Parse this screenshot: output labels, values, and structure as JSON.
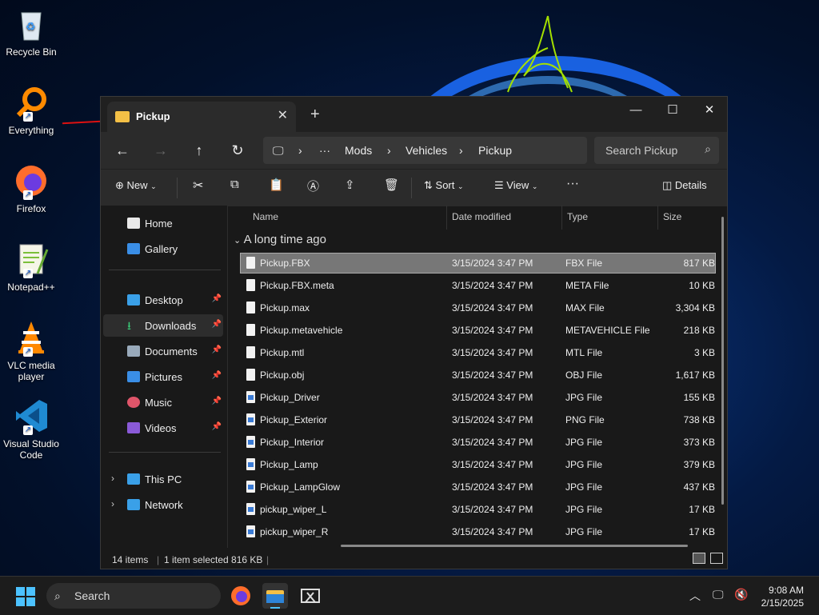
{
  "desktop": {
    "icons": [
      {
        "label": "Recycle Bin",
        "icon": "recycle-bin-icon"
      },
      {
        "label": "Everything",
        "icon": "everything-search-icon"
      },
      {
        "label": "Firefox",
        "icon": "firefox-icon"
      },
      {
        "label": "Notepad++",
        "icon": "notepadpp-icon"
      },
      {
        "label": "VLC media player",
        "icon": "vlc-icon"
      },
      {
        "label": "Visual Studio Code",
        "icon": "vscode-icon"
      }
    ]
  },
  "window": {
    "tab_title": "Pickup",
    "address": {
      "more": "···",
      "crumbs": [
        "Mods",
        "Vehicles",
        "Pickup"
      ]
    },
    "search_placeholder": "Search Pickup",
    "toolbar": {
      "new": "New",
      "sort": "Sort",
      "view": "View",
      "more": "···",
      "details": "Details"
    },
    "sidebar": {
      "home": "Home",
      "gallery": "Gallery",
      "quick": [
        "Desktop",
        "Downloads",
        "Documents",
        "Pictures",
        "Music",
        "Videos"
      ],
      "this_pc": "This PC",
      "network": "Network"
    },
    "columns": {
      "name": "Name",
      "date": "Date modified",
      "type": "Type",
      "size": "Size"
    },
    "group": "A long time ago",
    "files": [
      {
        "name": "Pickup.FBX",
        "date": "3/15/2024 3:47 PM",
        "type": "FBX File",
        "size": "817 KB"
      },
      {
        "name": "Pickup.FBX.meta",
        "date": "3/15/2024 3:47 PM",
        "type": "META File",
        "size": "10 KB"
      },
      {
        "name": "Pickup.max",
        "date": "3/15/2024 3:47 PM",
        "type": "MAX File",
        "size": "3,304 KB"
      },
      {
        "name": "Pickup.metavehicle",
        "date": "3/15/2024 3:47 PM",
        "type": "METAVEHICLE File",
        "size": "218 KB"
      },
      {
        "name": "Pickup.mtl",
        "date": "3/15/2024 3:47 PM",
        "type": "MTL File",
        "size": "3 KB"
      },
      {
        "name": "Pickup.obj",
        "date": "3/15/2024 3:47 PM",
        "type": "OBJ File",
        "size": "1,617 KB"
      },
      {
        "name": "Pickup_Driver",
        "date": "3/15/2024 3:47 PM",
        "type": "JPG File",
        "size": "155 KB"
      },
      {
        "name": "Pickup_Exterior",
        "date": "3/15/2024 3:47 PM",
        "type": "PNG File",
        "size": "738 KB"
      },
      {
        "name": "Pickup_Interior",
        "date": "3/15/2024 3:47 PM",
        "type": "JPG File",
        "size": "373 KB"
      },
      {
        "name": "Pickup_Lamp",
        "date": "3/15/2024 3:47 PM",
        "type": "JPG File",
        "size": "379 KB"
      },
      {
        "name": "Pickup_LampGlow",
        "date": "3/15/2024 3:47 PM",
        "type": "JPG File",
        "size": "437 KB"
      },
      {
        "name": "pickup_wiper_L",
        "date": "3/15/2024 3:47 PM",
        "type": "JPG File",
        "size": "17 KB"
      },
      {
        "name": "pickup_wiper_R",
        "date": "3/15/2024 3:47 PM",
        "type": "JPG File",
        "size": "17 KB"
      }
    ],
    "status": {
      "count": "14 items",
      "selected": "1 item selected  816 KB"
    }
  },
  "taskbar": {
    "search_label": "Search",
    "time": "9:08 AM",
    "date": "2/15/2025"
  },
  "colors": {
    "accent": "#4cc2ff",
    "folder": "#f4c046",
    "selection": "#777777"
  }
}
